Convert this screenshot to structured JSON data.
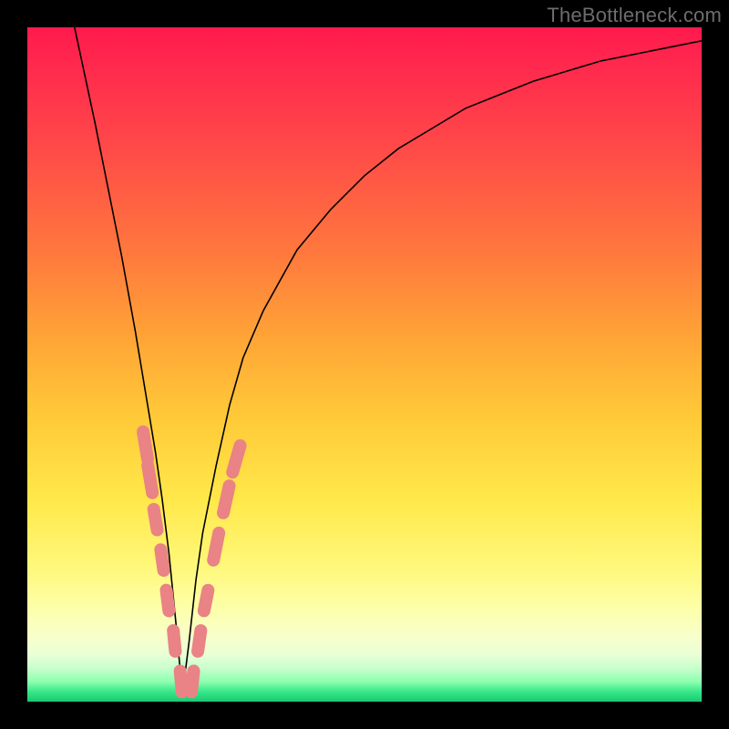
{
  "watermark": "TheBottleneck.com",
  "colors": {
    "frame": "#000000",
    "gradient_top": "#ff1a4d",
    "gradient_mid": "#ffe84a",
    "gradient_bottom": "#18c96f",
    "curve": "#000000",
    "markers": "#e98385"
  },
  "chart_data": {
    "type": "line",
    "title": "",
    "xlabel": "",
    "ylabel": "",
    "xlim": [
      0,
      100
    ],
    "ylim": [
      0,
      100
    ],
    "note": "No axis ticks or numeric labels are rendered in the image; values are estimated from pixel position on a 0–100 normalized scale. The curve is V-shaped with minimum near x≈23, y≈0. Pink lozenge markers cluster along both arms near the trough.",
    "series": [
      {
        "name": "curve",
        "x": [
          7,
          10,
          12,
          14,
          16,
          18,
          19,
          20,
          21,
          22,
          23,
          24,
          25,
          26,
          28,
          30,
          32,
          35,
          40,
          45,
          50,
          55,
          60,
          65,
          70,
          75,
          80,
          85,
          90,
          95,
          100
        ],
        "y": [
          100,
          86,
          76,
          66,
          55,
          43,
          37,
          30,
          22,
          12,
          1,
          9,
          18,
          25,
          35,
          44,
          51,
          58,
          67,
          73,
          78,
          82,
          85,
          88,
          90,
          92,
          93.5,
          95,
          96,
          97,
          98
        ]
      }
    ],
    "markers": [
      {
        "x": 17.5,
        "y": 38,
        "len": 6
      },
      {
        "x": 18.2,
        "y": 33,
        "len": 6
      },
      {
        "x": 19.0,
        "y": 27,
        "len": 5
      },
      {
        "x": 20.0,
        "y": 21,
        "len": 5
      },
      {
        "x": 20.8,
        "y": 15,
        "len": 5
      },
      {
        "x": 21.8,
        "y": 9,
        "len": 5
      },
      {
        "x": 22.8,
        "y": 3,
        "len": 5
      },
      {
        "x": 24.5,
        "y": 3,
        "len": 5
      },
      {
        "x": 25.5,
        "y": 9,
        "len": 5
      },
      {
        "x": 26.5,
        "y": 15,
        "len": 5
      },
      {
        "x": 28.0,
        "y": 23,
        "len": 6
      },
      {
        "x": 29.5,
        "y": 30,
        "len": 6
      },
      {
        "x": 31.0,
        "y": 36,
        "len": 6
      }
    ]
  }
}
